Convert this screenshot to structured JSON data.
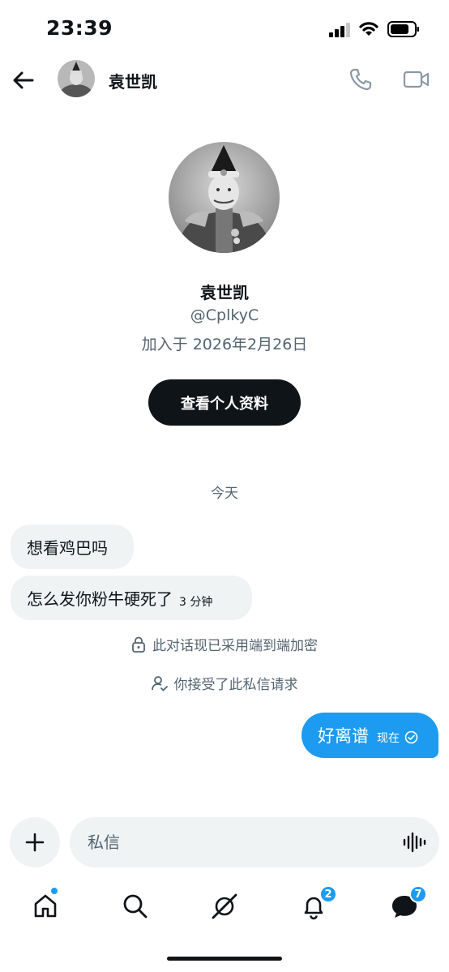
{
  "status_bar": {
    "time": "23:39"
  },
  "header": {
    "name": "袁世凯"
  },
  "profile": {
    "name": "袁世凯",
    "handle": "@CplkyC",
    "joined": "加入于 2026年2月26日",
    "view_profile_label": "查看个人资料"
  },
  "conversation": {
    "day_label": "今天",
    "incoming": [
      {
        "text": "想看鸡巴吗",
        "time": ""
      },
      {
        "text": "怎么发你粉牛硬死了",
        "time": "3 分钟"
      }
    ],
    "notes": {
      "encryption": "此对话现已采用端到端加密",
      "accepted": "你接受了此私信请求"
    },
    "outgoing": {
      "text": "好离谱",
      "time": "现在"
    }
  },
  "composer": {
    "placeholder": "私信"
  },
  "nav": {
    "notifications_badge": "2",
    "messages_badge": "7"
  },
  "colors": {
    "accent": "#1d9bf0",
    "text": "#0f1419",
    "secondary": "#536471",
    "bubble": "#eff3f4"
  },
  "icons": [
    "back-arrow-icon",
    "phone-icon",
    "video-icon",
    "lock-icon",
    "person-check-icon",
    "check-circle-icon",
    "plus-icon",
    "voice-wave-icon",
    "home-icon",
    "search-icon",
    "grok-icon",
    "bell-icon",
    "messages-icon"
  ]
}
